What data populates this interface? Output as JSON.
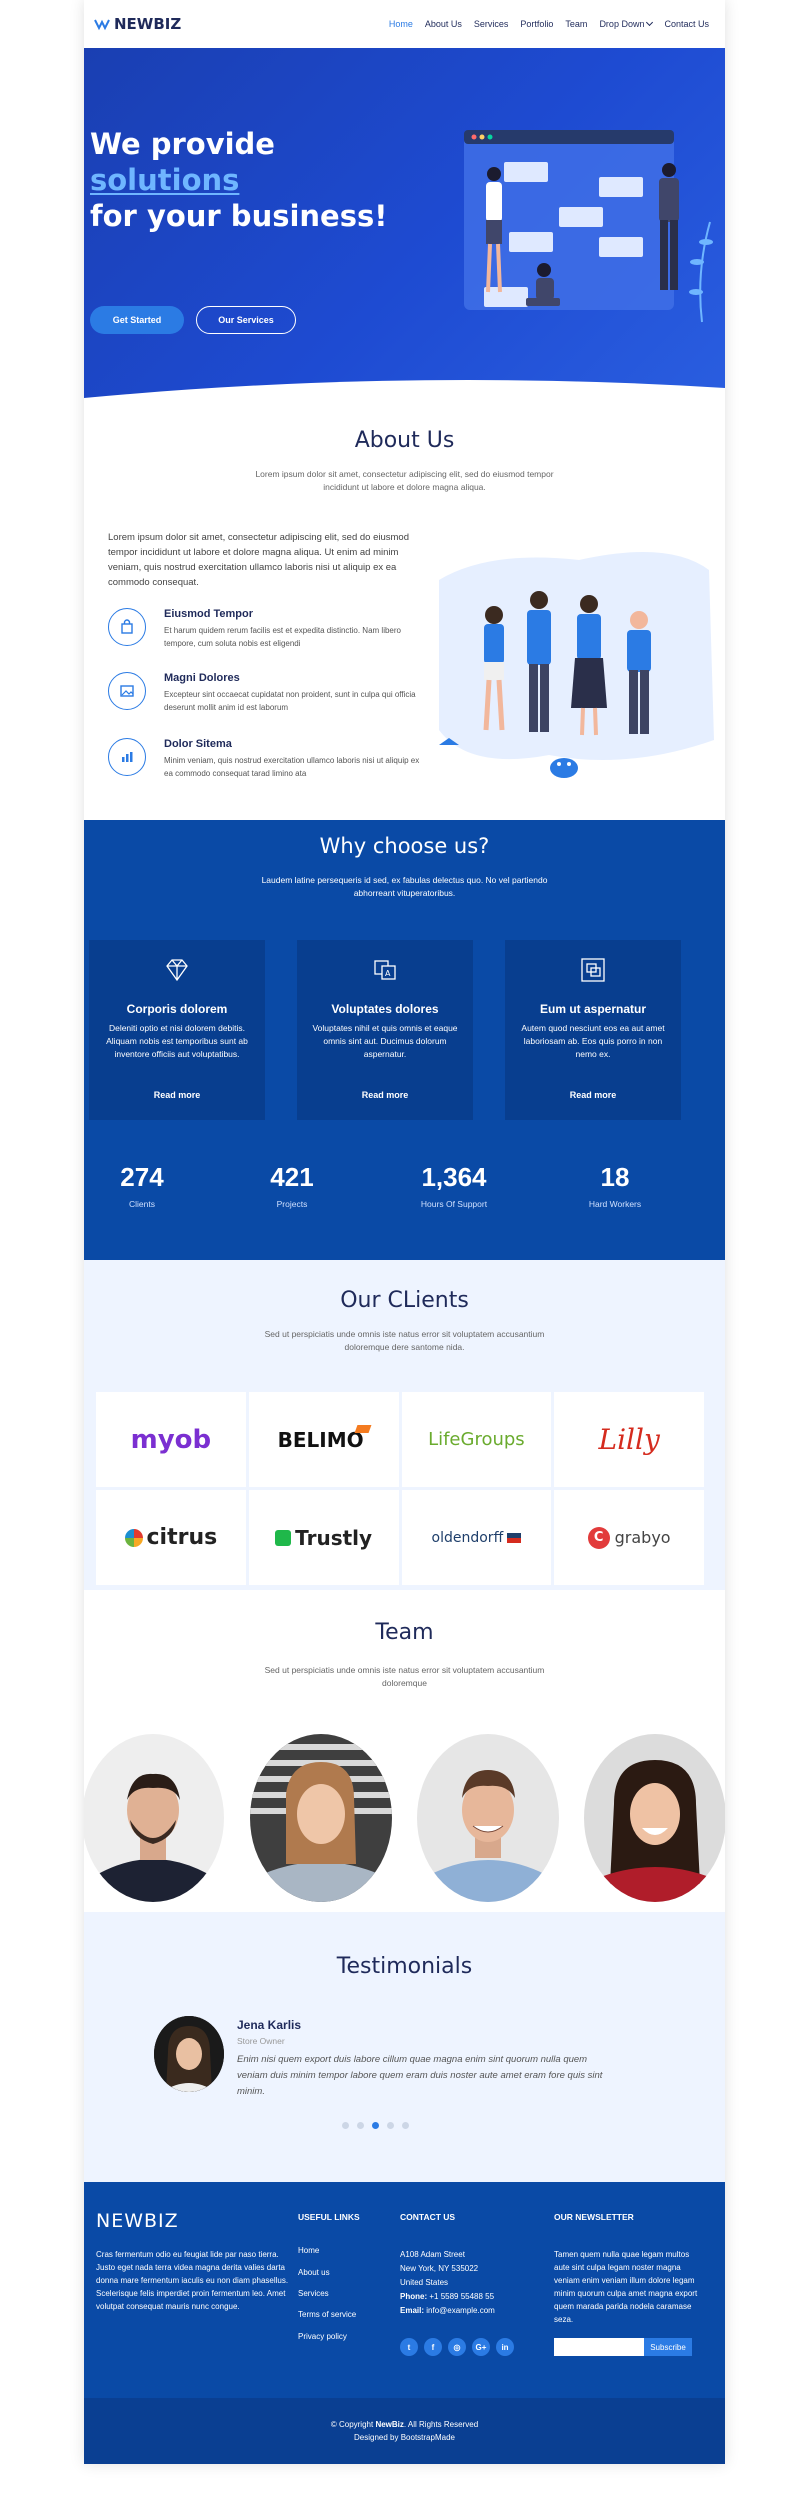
{
  "brand": "NEWBIZ",
  "nav": [
    {
      "label": "Home",
      "active": true
    },
    {
      "label": "About Us"
    },
    {
      "label": "Services"
    },
    {
      "label": "Portfolio"
    },
    {
      "label": "Team"
    },
    {
      "label": "Drop Down",
      "dropdown": true
    },
    {
      "label": "Contact Us"
    }
  ],
  "hero": {
    "line1": "We provide",
    "line2": "solutions",
    "line3": "for your business!",
    "primary_btn": "Get Started",
    "secondary_btn": "Our Services"
  },
  "about": {
    "title": "About Us",
    "subtitle": "Lorem ipsum dolor sit amet, consectetur adipiscing elit, sed do eiusmod tempor incididunt ut labore et dolore magna aliqua.",
    "intro": "Lorem ipsum dolor sit amet, consectetur adipiscing elit, sed do eiusmod tempor incididunt ut labore et dolore magna aliqua. Ut enim ad minim veniam, quis nostrud exercitation ullamco laboris nisi ut aliquip ex ea commodo consequat.",
    "features": [
      {
        "title": "Eiusmod Tempor",
        "desc": "Et harum quidem rerum facilis est et expedita distinctio. Nam libero tempore, cum soluta nobis est eligendi",
        "icon": "shopping-bag-icon"
      },
      {
        "title": "Magni Dolores",
        "desc": "Excepteur sint occaecat cupidatat non proident, sunt in culpa qui officia deserunt mollit anim id est laborum",
        "icon": "photo-icon"
      },
      {
        "title": "Dolor Sitema",
        "desc": "Minim veniam, quis nostrud exercitation ullamco laboris nisi ut aliquip ex ea commodo consequat tarad limino ata",
        "icon": "chart-icon"
      }
    ]
  },
  "why": {
    "title": "Why choose us?",
    "subtitle": "Laudem latine persequeris id sed, ex fabulas delectus quo. No vel partiendo abhorreant vituperatoribus.",
    "cards": [
      {
        "title": "Corporis dolorem",
        "desc": "Deleniti optio et nisi dolorem debitis. Aliquam nobis est temporibus sunt ab inventore officiis aut voluptatibus.",
        "link": "Read more",
        "icon": "diamond-icon"
      },
      {
        "title": "Voluptates dolores",
        "desc": "Voluptates nihil et quis omnis et eaque omnis sint aut. Ducimus dolorum aspernatur.",
        "link": "Read more",
        "icon": "language-icon"
      },
      {
        "title": "Eum ut aspernatur",
        "desc": "Autem quod nesciunt eos ea aut amet laboriosam ab. Eos quis porro in non nemo ex.",
        "link": "Read more",
        "icon": "object-group-icon"
      }
    ],
    "counts": [
      {
        "value": "274",
        "label": "Clients"
      },
      {
        "value": "421",
        "label": "Projects"
      },
      {
        "value": "1,364",
        "label": "Hours Of Support"
      },
      {
        "value": "18",
        "label": "Hard Workers"
      }
    ]
  },
  "clients": {
    "title": "Our CLients",
    "subtitle": "Sed ut perspiciatis unde omnis iste natus error sit voluptatem accusantium doloremque dere santome nida.",
    "logos": [
      "myob",
      "BELIMO",
      "LifeGroups",
      "Lilly",
      "citrus",
      "Trustly",
      "oldendorff",
      "grabyo"
    ]
  },
  "team": {
    "title": "Team",
    "subtitle": "Sed ut perspiciatis unde omnis iste natus error sit voluptatem accusantium doloremque"
  },
  "testimonials": {
    "title": "Testimonials",
    "name": "Jena Karlis",
    "role": "Store Owner",
    "quote": "Enim nisi quem export duis labore cillum quae magna enim sint quorum nulla quem veniam duis minim tempor labore quem eram duis noster aute amet eram fore quis sint minim."
  },
  "footer": {
    "logo": "NEWBIZ",
    "about": "Cras fermentum odio eu feugiat lide par naso tierra. Justo eget nada terra videa magna derita valies darta donna mare fermentum iaculis eu non diam phasellus. Scelerisque felis imperdiet proin fermentum leo. Amet volutpat consequat mauris nunc congue.",
    "links_title": "USEFUL LINKS",
    "links": [
      "Home",
      "About us",
      "Services",
      "Terms of service",
      "Privacy policy"
    ],
    "contact_title": "CONTACT US",
    "address1": "A108 Adam Street",
    "address2": "New York, NY 535022",
    "address3": "United States",
    "phone_label": "Phone:",
    "phone": "+1 5589 55488 55",
    "email_label": "Email:",
    "email": "info@example.com",
    "social": [
      "t",
      "f",
      "◎",
      "G+",
      "in"
    ],
    "newsletter_title": "OUR NEWSLETTER",
    "newsletter_text": "Tamen quem nulla quae legam multos aute sint culpa legam noster magna veniam enim veniam illum dolore legam minim quorum culpa amet magna export quem marada parida nodela caramase seza.",
    "subscribe": "Subscribe",
    "copyright_prefix": "© Copyright",
    "copyright_brand": "NewBiz",
    "copyright_suffix": ". All Rights Reserved",
    "designed": "Designed by BootstrapMade"
  },
  "colors": {
    "primary": "#2b7be4",
    "dark_blue": "#0a4aa6",
    "hero": "#1e4bd2",
    "light_bg": "#eef4ff"
  }
}
